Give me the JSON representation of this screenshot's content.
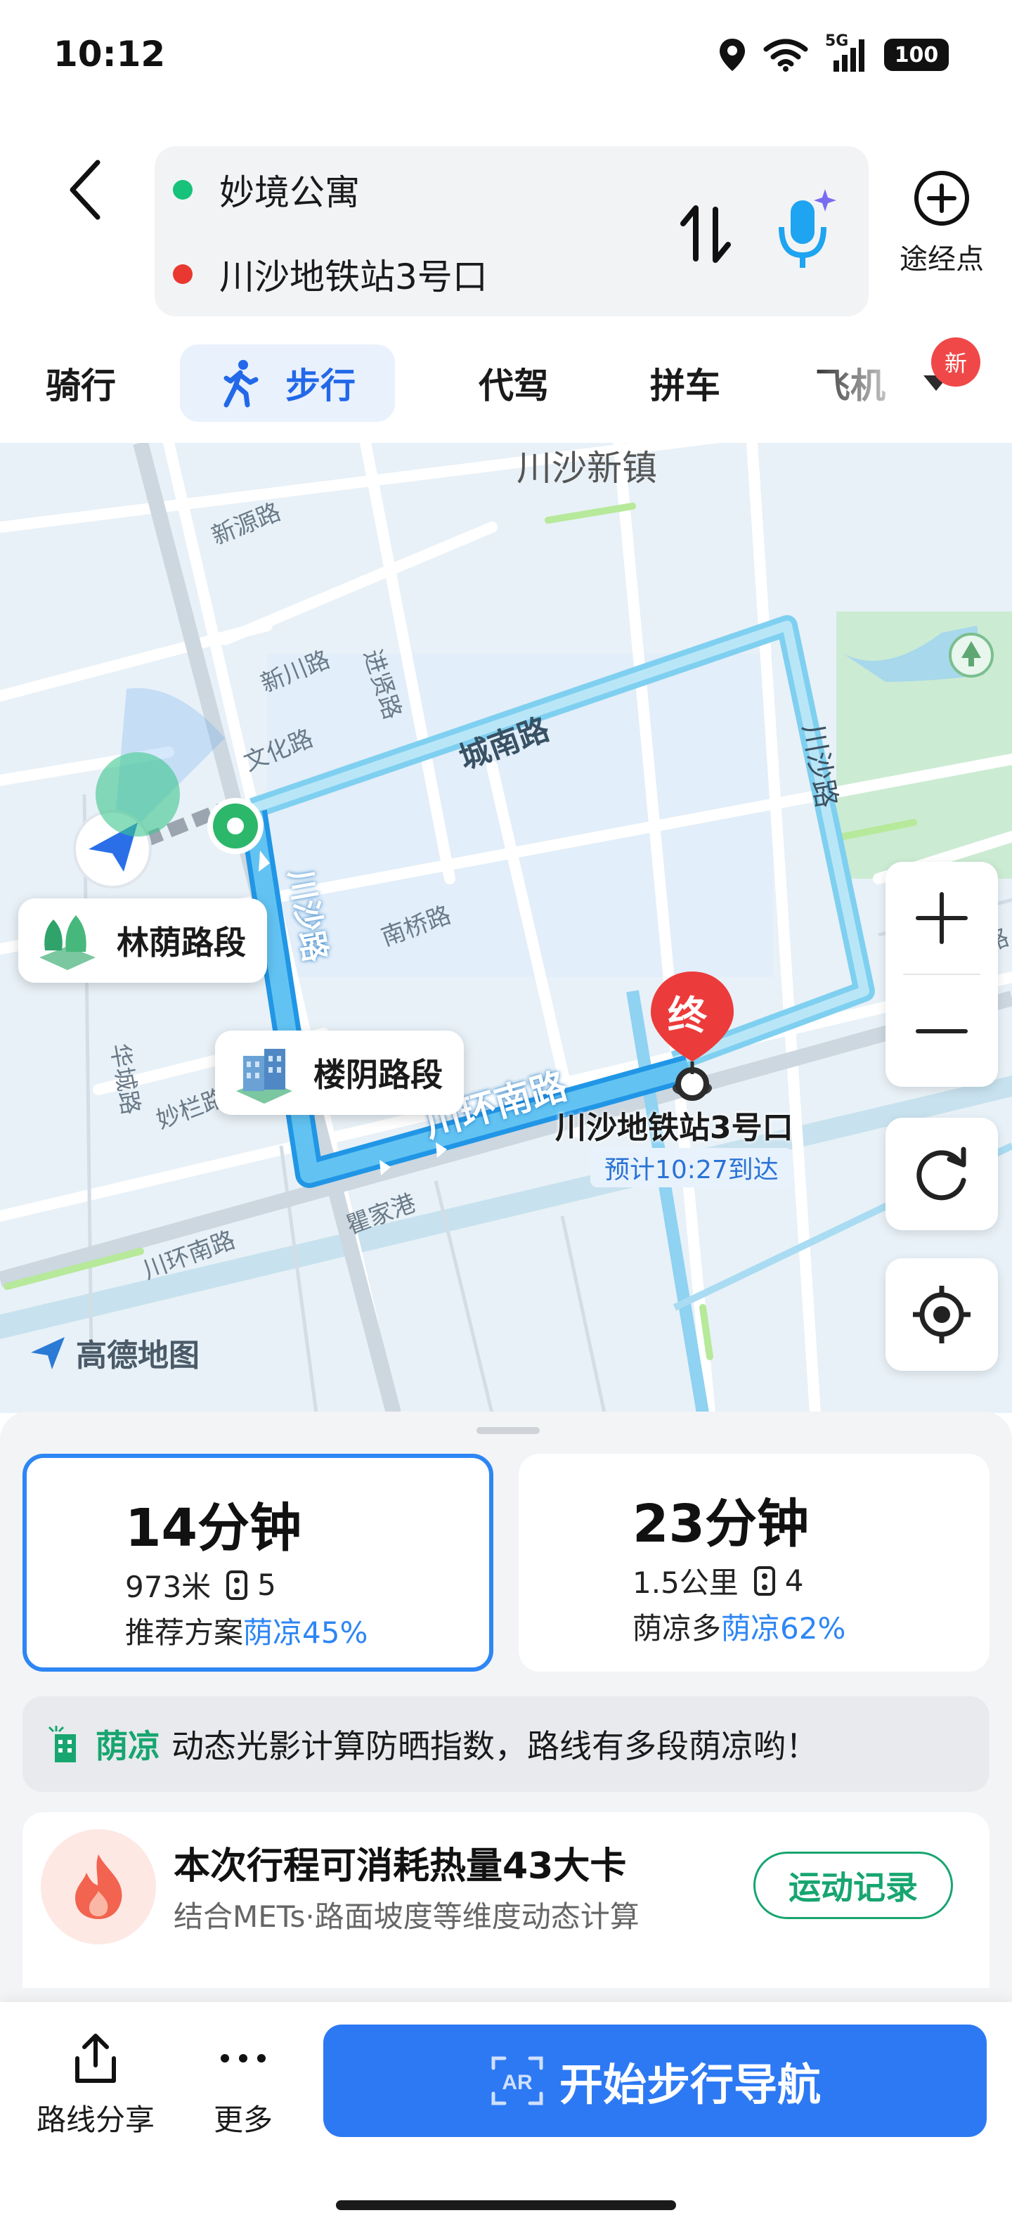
{
  "status_bar": {
    "time": "10:12",
    "network": "5G",
    "battery": "100"
  },
  "route": {
    "origin": "妙境公寓",
    "destination": "川沙地铁站3号口",
    "waypoint_label": "途经点",
    "origin_color": "#17c27a",
    "destination_color": "#e8382f"
  },
  "tabs": [
    {
      "label": "骑行",
      "active": false
    },
    {
      "label": "步行",
      "active": true
    },
    {
      "label": "代驾",
      "active": false
    },
    {
      "label": "拼车",
      "active": false
    },
    {
      "label": "飞机",
      "active": false
    }
  ],
  "new_badge": "新",
  "map": {
    "area_label": "川沙新镇",
    "roads": [
      "新源路",
      "新川路",
      "进贤路",
      "文化路",
      "城南路",
      "川沙路",
      "南桥路",
      "华城路",
      "妙栏路",
      "川环南路",
      "瞿家港",
      "川环南路",
      "路"
    ],
    "main_road_label": "川环南路",
    "vertical_road_label": "川沙路",
    "callout_forest": "林荫路段",
    "callout_building": "楼阴路段",
    "dest_marker": "终",
    "dest_name": "川沙地铁站3号口",
    "eta": "预计10:27到达",
    "logo": "高德地图",
    "route_color": "#7fd0f0"
  },
  "options": [
    {
      "time": "14分钟",
      "distance": "973米",
      "lights": "5",
      "desc_prefix": "推荐方案",
      "shade": "荫凉45%",
      "selected": true
    },
    {
      "time": "23分钟",
      "distance": "1.5公里",
      "lights": "4",
      "desc_prefix": "荫凉多",
      "shade": "荫凉62%",
      "selected": false
    }
  ],
  "shade_bar": {
    "brand": "荫凉",
    "text": "动态光影计算防晒指数，路线有多段荫凉哟！"
  },
  "calorie": {
    "title": "本次行程可消耗热量43大卡",
    "subtitle": "结合METs·路面坡度等维度动态计算",
    "button": "运动记录"
  },
  "actions": {
    "share": "路线分享",
    "more": "更多",
    "start": "开始步行导航",
    "ar": "AR"
  }
}
